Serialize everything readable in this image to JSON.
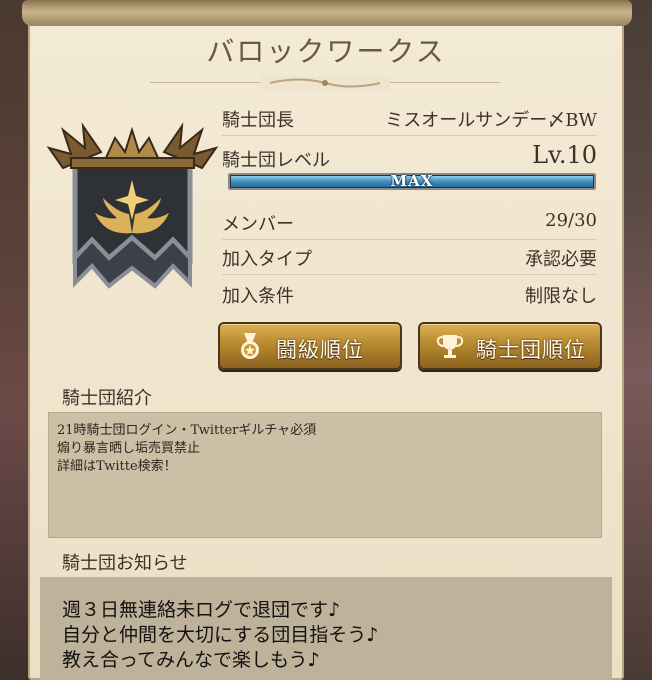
{
  "title": "バロックワークス",
  "info": {
    "leader_label": "騎士団長",
    "leader_value": "ミスオールサンデー〆BW",
    "level_label": "騎士団レベル",
    "level_value": "Lv.10",
    "level_bar_text": "MAX",
    "level_progress": 1.0,
    "members_label": "メンバー",
    "members_value": "29/30",
    "join_type_label": "加入タイプ",
    "join_type_value": "承認必要",
    "join_cond_label": "加入条件",
    "join_cond_value": "制限なし"
  },
  "buttons": {
    "battle_rank": "闘級順位",
    "guild_rank": "騎士団順位"
  },
  "intro": {
    "title": "騎士団紹介",
    "lines": [
      "21時騎士団ログイン・Twitterギルチャ必須",
      "煽り暴言晒し垢売買禁止",
      "詳細はTwitte検索！"
    ]
  },
  "notice": {
    "title": "騎士団お知らせ",
    "lines": [
      "週３日無連絡未ログで退団です♪",
      "自分と仲間を大切にする団目指そう♪",
      "教え合ってみんなで楽しもう♪"
    ]
  },
  "colors": {
    "parchment": "#f3ead6",
    "button_gold": "#c9993a",
    "bar_blue": "#3f8fc0",
    "banner_dark": "#2e3136"
  },
  "icons": {
    "emblem": "guild-banner-emblem",
    "battle_rank": "medal-icon",
    "guild_rank": "trophy-icon"
  }
}
